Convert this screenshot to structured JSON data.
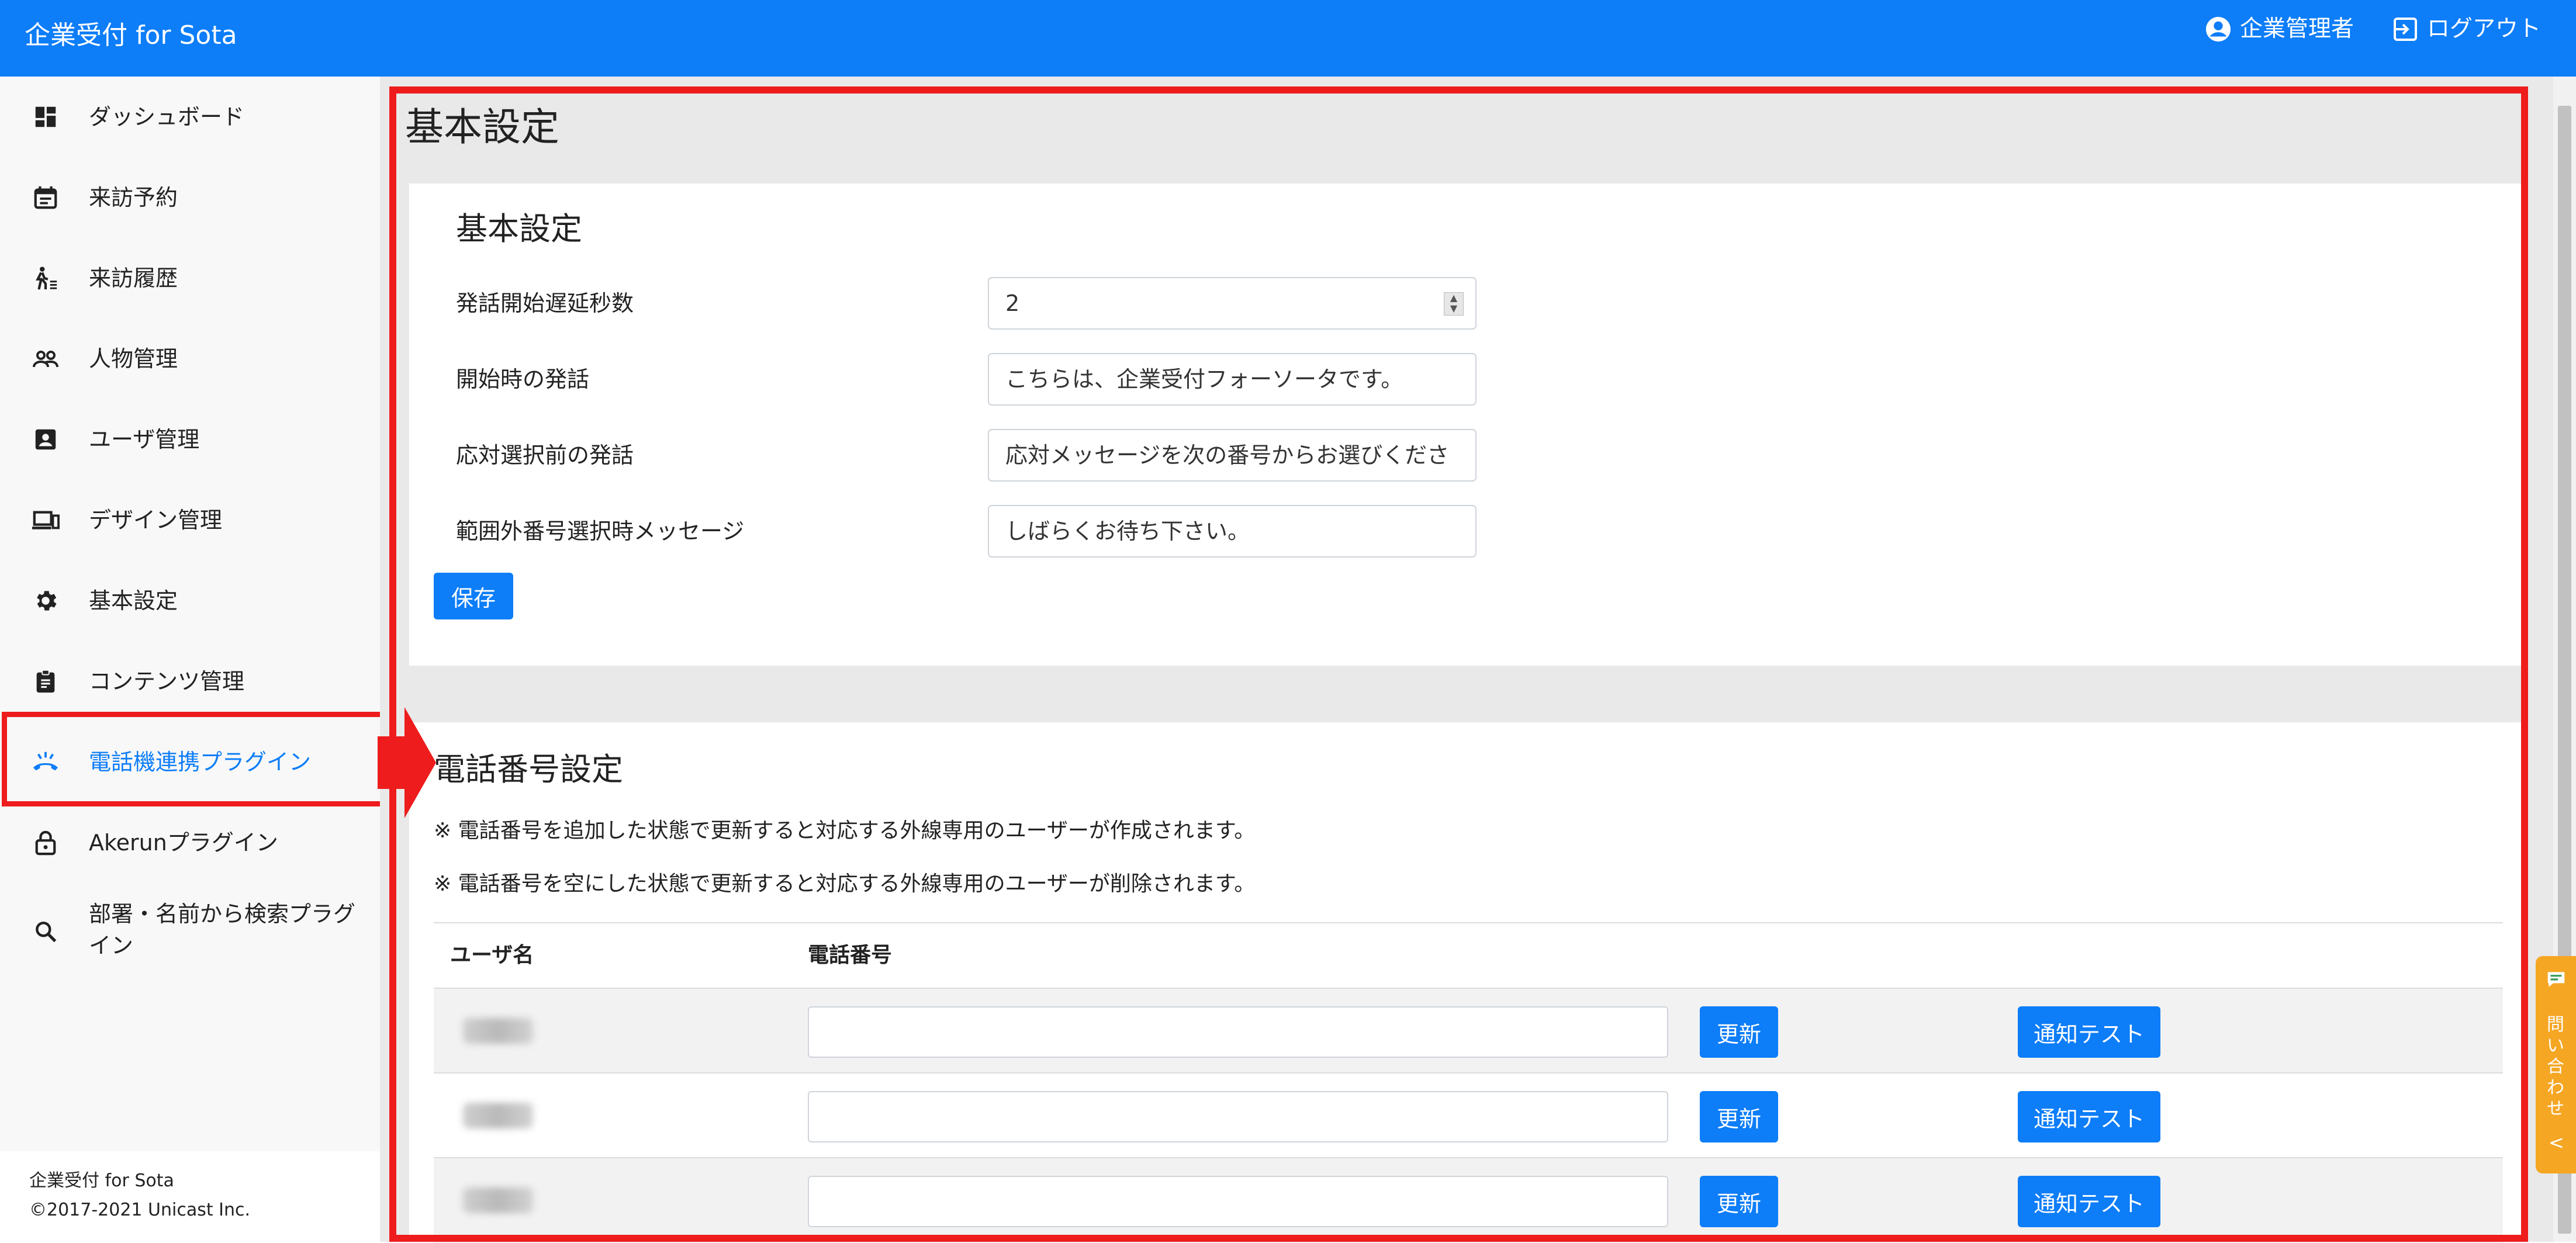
{
  "header": {
    "app_title": "企業受付 for Sota",
    "user_label": "企業管理者",
    "logout_label": "ログアウト"
  },
  "sidebar": {
    "items": [
      {
        "label": "ダッシュボード",
        "icon": "dashboard-icon"
      },
      {
        "label": "来訪予約",
        "icon": "calendar-icon"
      },
      {
        "label": "来訪履歴",
        "icon": "walking-person-icon"
      },
      {
        "label": "人物管理",
        "icon": "people-icon"
      },
      {
        "label": "ユーザ管理",
        "icon": "contact-card-icon"
      },
      {
        "label": "デザイン管理",
        "icon": "devices-icon"
      },
      {
        "label": "基本設定",
        "icon": "gear-icon"
      },
      {
        "label": "コンテンツ管理",
        "icon": "clipboard-icon"
      },
      {
        "label": "電話機連携プラグイン",
        "icon": "phone-ringing-icon",
        "active": true
      },
      {
        "label": "Akerunプラグイン",
        "icon": "lock-icon"
      },
      {
        "label": "部署・名前から検索プラグ",
        "label2": "イン",
        "icon": "search-icon"
      }
    ],
    "footer_line1": "企業受付 for Sota",
    "footer_line2": "©2017-2021 Unicast Inc."
  },
  "main": {
    "page_title": "基本設定",
    "basic": {
      "section_title": "基本設定",
      "fields": [
        {
          "label": "発話開始遅延秒数",
          "value": "2"
        },
        {
          "label": "開始時の発話",
          "value": "こちらは、企業受付フォーソータです。"
        },
        {
          "label": "応対選択前の発話",
          "value": "応対メッセージを次の番号からお選びくださ"
        },
        {
          "label": "範囲外番号選択時メッセージ",
          "value": "しばらくお待ち下さい。"
        }
      ],
      "save_label": "保存"
    },
    "phone": {
      "section_title": "電話番号設定",
      "note1": "※ 電話番号を追加した状態で更新すると対応する外線専用のユーザーが作成されます。",
      "note2": "※ 電話番号を空にした状態で更新すると対応する外線専用のユーザーが削除されます。",
      "col_user": "ユーザ名",
      "col_phone": "電話番号",
      "update_label": "更新",
      "test_label": "通知テスト",
      "rows": [
        {
          "phone": ""
        },
        {
          "phone": ""
        },
        {
          "phone": ""
        }
      ]
    }
  },
  "inquiry": {
    "label": "問い合わせ",
    "chevron": "<"
  },
  "colors": {
    "primary": "#0d7df8",
    "highlight": "#ee1c1c",
    "inquiry": "#f5a623"
  }
}
